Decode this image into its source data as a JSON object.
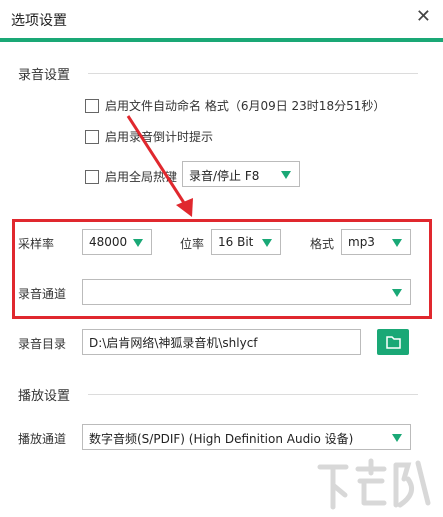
{
  "window": {
    "title": "选项设置"
  },
  "recording": {
    "section_title": "录音设置",
    "auto_name_label": "启用文件自动命名 格式（6月09日 23时18分51秒）",
    "countdown_label": "启用录音倒计时提示",
    "hotkey_label": "启用全局热键",
    "hotkey_value": "录音/停止 F8",
    "sample_rate_label": "采样率",
    "sample_rate_value": "48000",
    "bit_depth_label": "位率",
    "bit_depth_value": "16 Bit",
    "format_label": "格式",
    "format_value": "mp3",
    "channel_label": "录音通道",
    "channel_value": "",
    "dir_label": "录音目录",
    "dir_value": "D:\\启肯网络\\神狐录音机\\shlycf"
  },
  "playback": {
    "section_title": "播放设置",
    "channel_label": "播放通道",
    "channel_value": "数字音频(S/PDIF) (High Definition Audio 设备)"
  },
  "colors": {
    "accent": "#1aa876",
    "highlight": "#e0282e"
  },
  "icons": {
    "close": "close-icon",
    "folder": "folder-icon",
    "dropdown": "chevron-down-icon"
  }
}
